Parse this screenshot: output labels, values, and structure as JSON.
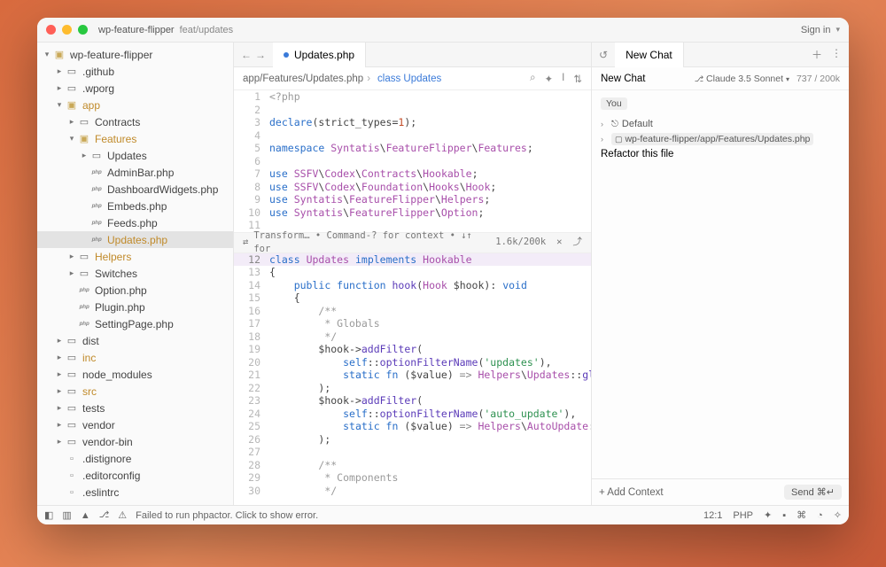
{
  "titlebar": {
    "project": "wp-feature-flipper",
    "branch": "feat/updates",
    "signin": "Sign in"
  },
  "sidebar": {
    "root": "wp-feature-flipper",
    "items": [
      {
        "d": 1,
        "t": "folder",
        "l": ".github"
      },
      {
        "d": 1,
        "t": "folder",
        "l": ".wporg"
      },
      {
        "d": 1,
        "t": "folder-open",
        "l": "app",
        "a": true
      },
      {
        "d": 2,
        "t": "folder",
        "l": "Contracts"
      },
      {
        "d": 2,
        "t": "folder-open",
        "l": "Features",
        "a": true
      },
      {
        "d": 3,
        "t": "folder",
        "l": "Updates"
      },
      {
        "d": 3,
        "t": "php",
        "l": "AdminBar.php"
      },
      {
        "d": 3,
        "t": "php",
        "l": "DashboardWidgets.php"
      },
      {
        "d": 3,
        "t": "php",
        "l": "Embeds.php"
      },
      {
        "d": 3,
        "t": "php",
        "l": "Feeds.php"
      },
      {
        "d": 3,
        "t": "php",
        "l": "Updates.php",
        "sel": true,
        "a": true
      },
      {
        "d": 2,
        "t": "folder",
        "l": "Helpers",
        "a": true
      },
      {
        "d": 2,
        "t": "folder",
        "l": "Switches"
      },
      {
        "d": 2,
        "t": "php",
        "l": "Option.php"
      },
      {
        "d": 2,
        "t": "php",
        "l": "Plugin.php"
      },
      {
        "d": 2,
        "t": "php",
        "l": "SettingPage.php"
      },
      {
        "d": 1,
        "t": "folder",
        "l": "dist"
      },
      {
        "d": 1,
        "t": "folder",
        "l": "inc",
        "a": true
      },
      {
        "d": 1,
        "t": "folder",
        "l": "node_modules"
      },
      {
        "d": 1,
        "t": "folder",
        "l": "src",
        "a": true
      },
      {
        "d": 1,
        "t": "folder",
        "l": "tests"
      },
      {
        "d": 1,
        "t": "folder",
        "l": "vendor"
      },
      {
        "d": 1,
        "t": "folder",
        "l": "vendor-bin"
      },
      {
        "d": 1,
        "t": "file",
        "l": ".distignore"
      },
      {
        "d": 1,
        "t": "file",
        "l": ".editorconfig"
      },
      {
        "d": 1,
        "t": "file",
        "l": ".eslintrc"
      }
    ]
  },
  "editor": {
    "tab": "Updates.php",
    "breadcrumb_path": "app/Features/Updates.php",
    "breadcrumb_sep": "›",
    "breadcrumb_class": "class Updates",
    "inline_hint": "Transform… • Command-? for context • ↓↑ for",
    "inline_tokens": "1.6k/200k"
  },
  "chat": {
    "tab": "New Chat",
    "title": "New Chat",
    "model": "Claude 3.5 Sonnet",
    "tokens": "737 / 200k",
    "you": "You",
    "mode": "Default",
    "context_file": "wp-feature-flipper/app/Features/Updates.php",
    "prompt": "Refactor this file",
    "add_context": "+ Add Context",
    "send": "Send ⌘↵"
  },
  "status": {
    "error": "Failed to run phpactor. Click to show error.",
    "pos": "12:1",
    "lang": "PHP"
  }
}
